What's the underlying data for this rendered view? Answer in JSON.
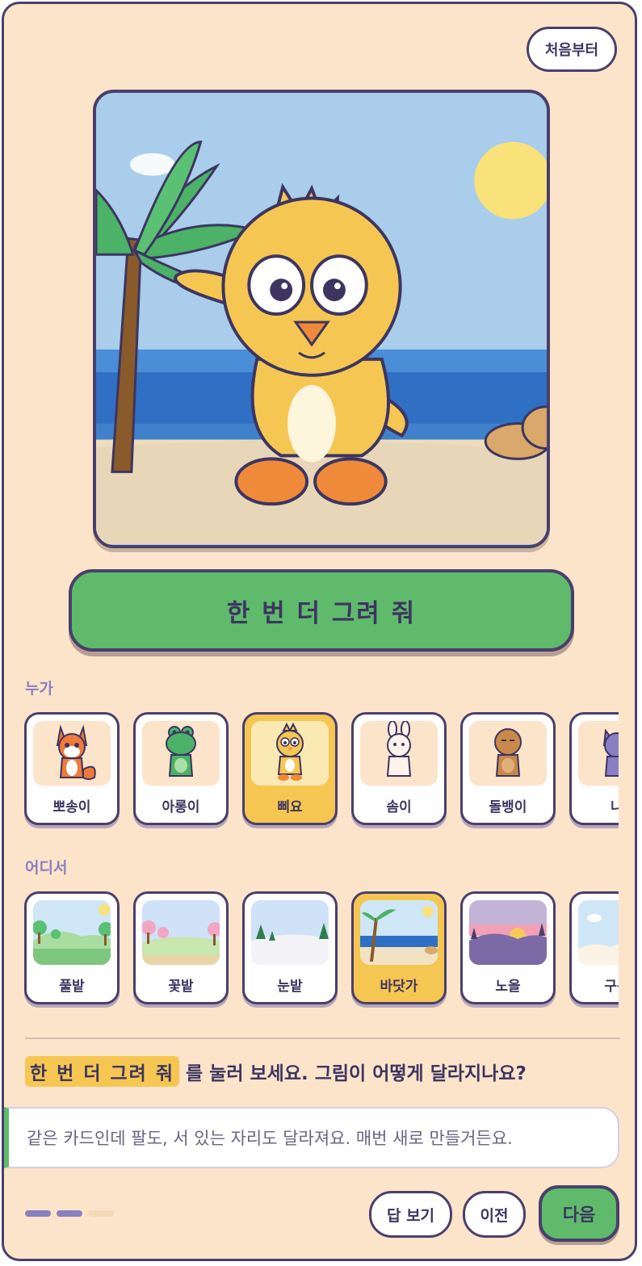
{
  "header": {
    "restart_label": "처음부터"
  },
  "scene": {
    "character": "삐요",
    "place": "바닷가",
    "description_icons": [
      "palm-tree",
      "sun",
      "sea",
      "sand",
      "chick-character"
    ]
  },
  "redraw_button": {
    "label": "한 번 더 그려 줘"
  },
  "who": {
    "label": "누가",
    "items": [
      {
        "label": "뽀송이",
        "icon": "fox-icon",
        "selected": false
      },
      {
        "label": "아롱이",
        "icon": "frog-icon",
        "selected": false
      },
      {
        "label": "삐요",
        "icon": "chick-icon",
        "selected": true
      },
      {
        "label": "솜이",
        "icon": "bunny-icon",
        "selected": false
      },
      {
        "label": "돌뱅이",
        "icon": "bear-icon",
        "selected": false
      },
      {
        "label": "나",
        "icon": "cat-icon",
        "selected": false
      }
    ]
  },
  "where": {
    "label": "어디서",
    "items": [
      {
        "label": "풀밭",
        "icon": "meadow-icon",
        "selected": false
      },
      {
        "label": "꽃밭",
        "icon": "flower-field-icon",
        "selected": false
      },
      {
        "label": "눈밭",
        "icon": "snow-field-icon",
        "selected": false
      },
      {
        "label": "바닷가",
        "icon": "beach-icon",
        "selected": true
      },
      {
        "label": "노을",
        "icon": "sunset-icon",
        "selected": false
      },
      {
        "label": "구름",
        "icon": "cloud-icon",
        "selected": false
      }
    ]
  },
  "prompt": {
    "highlight": "한 번 더 그려 줘",
    "text": "를 눌러 보세요. 그림이 어떻게 달라지나요?"
  },
  "answer": {
    "text": "같은 카드인데 팔도, 서 있는 자리도 달라져요. 매번 새로 만들거든요."
  },
  "progress": {
    "current_step": 2,
    "total_steps": 3
  },
  "footer": {
    "show_answer_label": "답 보기",
    "prev_label": "이전",
    "next_label": "다음"
  },
  "colors": {
    "background": "#fce4cb",
    "accent_green": "#5fba6c",
    "highlight_yellow": "#f6c653",
    "border": "#4a3f6b",
    "label_purple": "#8a7fc0"
  }
}
